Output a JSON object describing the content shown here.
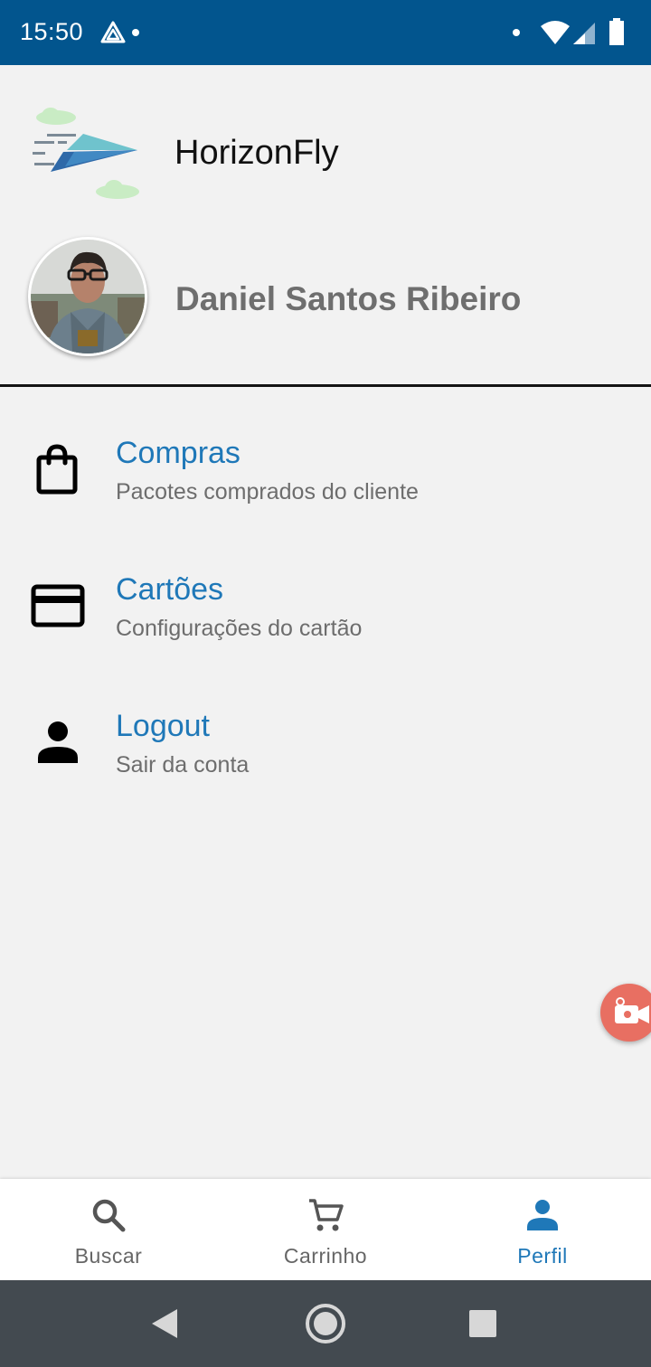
{
  "status_bar": {
    "time": "15:50"
  },
  "header": {
    "app_name": "HorizonFly",
    "user_name": "Daniel Santos Ribeiro"
  },
  "menu": [
    {
      "icon": "shopping-bag-icon",
      "title": "Compras",
      "subtitle": "Pacotes comprados do cliente"
    },
    {
      "icon": "credit-card-icon",
      "title": "Cartões",
      "subtitle": "Configurações do cartão"
    },
    {
      "icon": "person-icon",
      "title": "Logout",
      "subtitle": "Sair da conta"
    }
  ],
  "bottom_nav": [
    {
      "icon": "search-icon",
      "label": "Buscar",
      "active": false
    },
    {
      "icon": "cart-icon",
      "label": "Carrinho",
      "active": false
    },
    {
      "icon": "person-icon",
      "label": "Perfil",
      "active": true
    }
  ],
  "colors": {
    "status_bar": "#02558e",
    "accent": "#1f78b8",
    "float_button": "#e86f62",
    "system_nav": "#434a50"
  }
}
